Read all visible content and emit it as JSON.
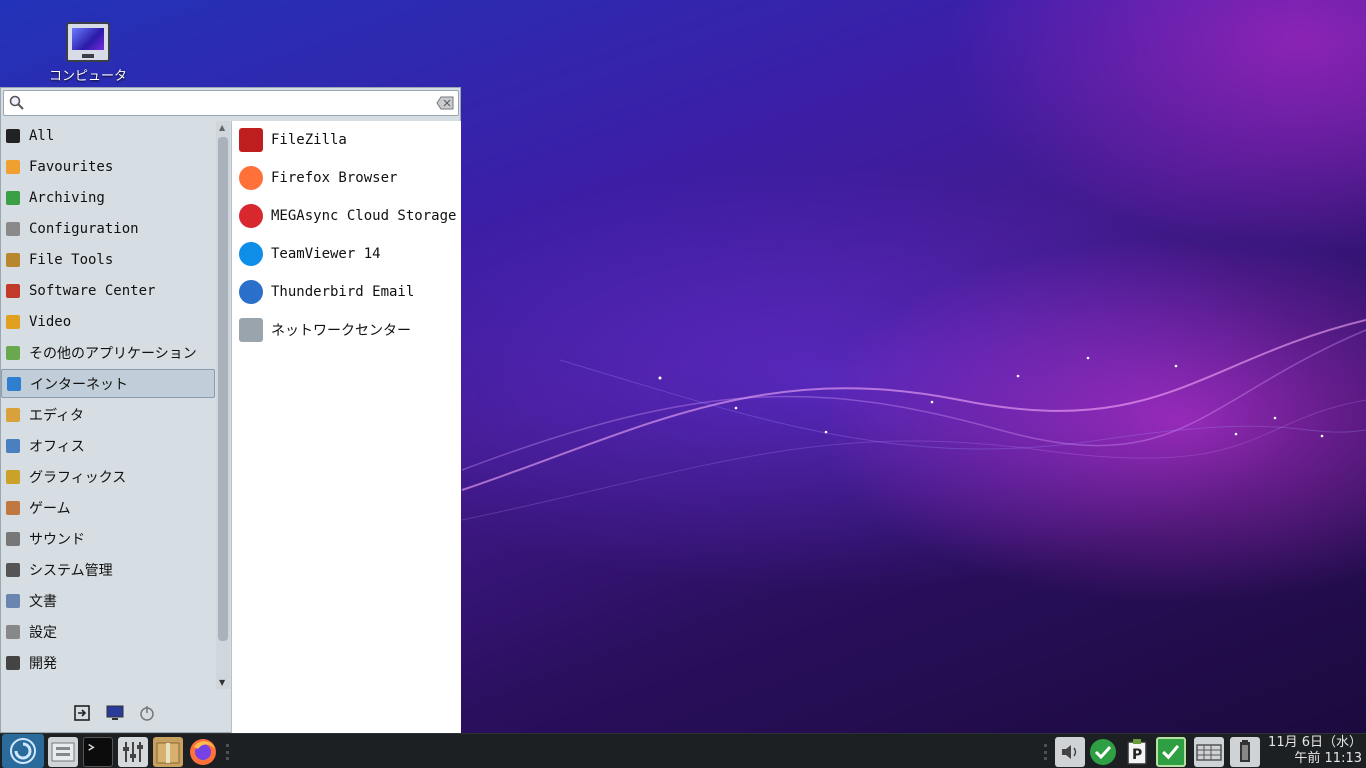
{
  "desktop": {
    "icons": [
      {
        "label": "コンピュータ",
        "icon": "computer-icon"
      }
    ]
  },
  "menu": {
    "search": {
      "value": "",
      "placeholder": ""
    },
    "categories": [
      {
        "label": "All",
        "icon": "star-icon",
        "color": "#222222"
      },
      {
        "label": "Favourites",
        "icon": "favourites-icon",
        "color": "#f0a030"
      },
      {
        "label": "Archiving",
        "icon": "archive-icon",
        "color": "#3aa048"
      },
      {
        "label": "Configuration",
        "icon": "config-icon",
        "color": "#8a8a8a"
      },
      {
        "label": "File Tools",
        "icon": "file-tools-icon",
        "color": "#b8862c"
      },
      {
        "label": "Software Center",
        "icon": "software-center-icon",
        "color": "#c0392b"
      },
      {
        "label": "Video",
        "icon": "video-icon",
        "color": "#e0a020"
      },
      {
        "label": "その他のアプリケーション",
        "icon": "other-apps-icon",
        "color": "#6aa84f"
      },
      {
        "label": "インターネット",
        "icon": "internet-icon",
        "color": "#2f7fd0",
        "selected": true
      },
      {
        "label": "エディタ",
        "icon": "editor-icon",
        "color": "#d9a13b"
      },
      {
        "label": "オフィス",
        "icon": "office-icon",
        "color": "#4a7fc0"
      },
      {
        "label": "グラフィックス",
        "icon": "graphics-icon",
        "color": "#c9a227"
      },
      {
        "label": "ゲーム",
        "icon": "game-icon",
        "color": "#c07840"
      },
      {
        "label": "サウンド",
        "icon": "sound-icon",
        "color": "#777777"
      },
      {
        "label": "システム管理",
        "icon": "system-admin-icon",
        "color": "#555555"
      },
      {
        "label": "文書",
        "icon": "document-icon",
        "color": "#6a86b0"
      },
      {
        "label": "設定",
        "icon": "settings-icon",
        "color": "#888888"
      },
      {
        "label": "開発",
        "icon": "development-icon",
        "color": "#444444"
      }
    ],
    "apps": [
      {
        "label": "FileZilla",
        "icon": "filezilla-icon",
        "color": "#bf1e1e"
      },
      {
        "label": "Firefox Browser",
        "icon": "firefox-icon",
        "color": "#ff7139"
      },
      {
        "label": "MEGAsync Cloud Storage",
        "icon": "mega-icon",
        "color": "#d9272e"
      },
      {
        "label": "TeamViewer 14",
        "icon": "teamviewer-icon",
        "color": "#0e8ee9"
      },
      {
        "label": "Thunderbird Email",
        "icon": "thunderbird-icon",
        "color": "#2a6fc9"
      },
      {
        "label": "ネットワークセンター",
        "icon": "network-center-icon",
        "color": "#9aa4ad"
      }
    ],
    "bottom_actions": [
      {
        "icon": "logout-icon"
      },
      {
        "icon": "lock-screen-icon"
      },
      {
        "icon": "power-icon"
      }
    ]
  },
  "taskbar": {
    "launchers": [
      {
        "icon": "start-menu-icon",
        "color": "#2b6b9c"
      },
      {
        "icon": "file-manager-icon",
        "color": "#d0d4d8"
      },
      {
        "icon": "terminal-icon",
        "color": "#111111"
      },
      {
        "icon": "mixer-icon",
        "color": "#cfd3d6"
      },
      {
        "icon": "archive-manager-icon",
        "color": "#c8a060"
      },
      {
        "icon": "firefox-icon",
        "color": "#ff7139"
      }
    ],
    "tray": [
      {
        "icon": "volume-icon"
      },
      {
        "icon": "update-ok-icon",
        "color": "#2ea043"
      },
      {
        "icon": "clipboard-icon"
      },
      {
        "icon": "task-ok-icon",
        "color": "#2ea043"
      },
      {
        "icon": "keyboard-icon"
      },
      {
        "icon": "battery-icon"
      }
    ],
    "clock": {
      "date": "11月 6日（水）",
      "time": "午前 11:13"
    }
  },
  "colors": {
    "accent": "#2b6b9c",
    "menu_bg": "#d6dde3",
    "selection": "#c1cdd8"
  }
}
